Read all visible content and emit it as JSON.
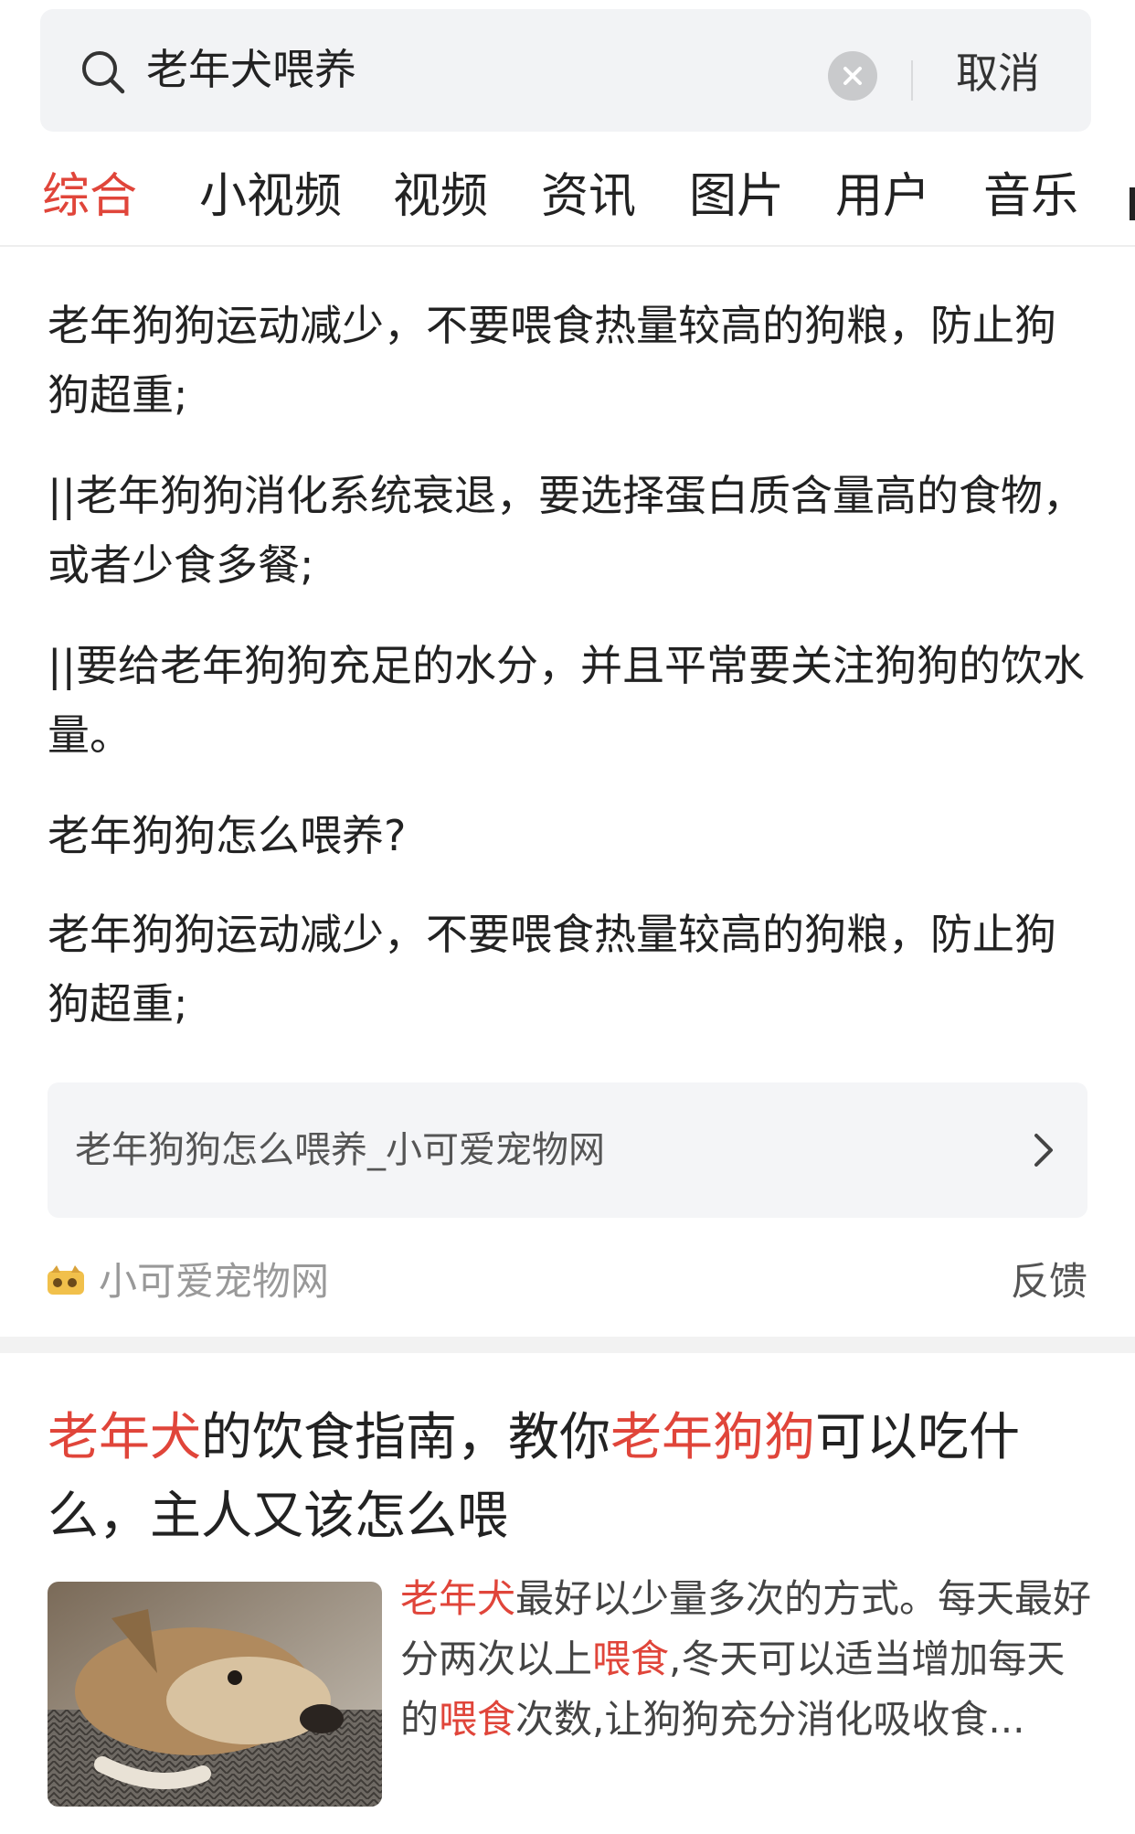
{
  "search": {
    "query": "老年犬喂养",
    "cancel_label": "取消"
  },
  "tabs": [
    {
      "label": "综合",
      "active": true
    },
    {
      "label": "小视频",
      "active": false
    },
    {
      "label": "视频",
      "active": false
    },
    {
      "label": "资讯",
      "active": false
    },
    {
      "label": "图片",
      "active": false
    },
    {
      "label": "用户",
      "active": false
    },
    {
      "label": "音乐",
      "active": false
    }
  ],
  "result1": {
    "paragraphs": [
      "老年狗狗运动减少，不要喂食热量较高的狗粮，防止狗狗超重;",
      "||老年狗狗消化系统衰退，要选择蛋白质含量高的食物，或者少食多餐;",
      "||要给老年狗狗充足的水分，并且平常要关注狗狗的饮水量。",
      "老年狗狗怎么喂养?",
      "老年狗狗运动减少，不要喂食热量较高的狗粮，防止狗狗超重;"
    ],
    "source_link": "老年狗狗怎么喂养_小可爱宠物网",
    "site_name": "小可爱宠物网",
    "feedback_label": "反馈"
  },
  "result2": {
    "title_parts": [
      {
        "text": "老年犬",
        "hl": true
      },
      {
        "text": "的饮食指南，教你",
        "hl": false
      },
      {
        "text": "老年狗狗",
        "hl": true
      },
      {
        "text": "可以吃什么，主人又该怎么喂",
        "hl": false
      }
    ],
    "body_parts": [
      {
        "text": "老年犬",
        "hl": true
      },
      {
        "text": "最好以少量多次的方式。每天最好分两次以上",
        "hl": false
      },
      {
        "text": "喂食",
        "hl": true
      },
      {
        "text": ",冬天可以适当增加每天的",
        "hl": false
      },
      {
        "text": "喂食",
        "hl": true
      },
      {
        "text": "次数,让狗狗充分消化吸收食...",
        "hl": false
      }
    ]
  },
  "colors": {
    "accent": "#e0453a",
    "text": "#222222",
    "muted": "#999999",
    "card_bg": "#f4f5f7"
  }
}
